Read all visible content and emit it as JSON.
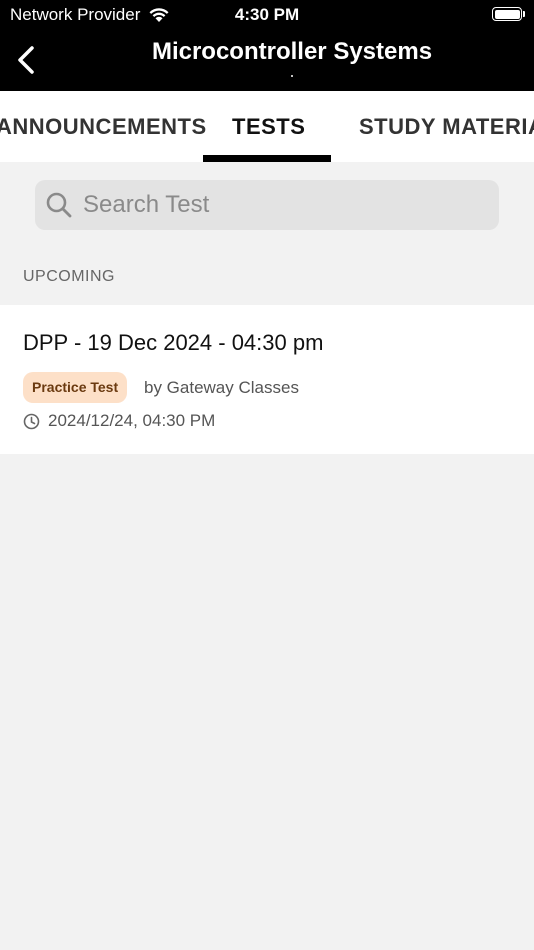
{
  "status": {
    "carrier": "Network Provider",
    "time": "4:30 PM"
  },
  "header": {
    "title": "Microcontroller Systems"
  },
  "tabs": [
    {
      "label": "ANNOUNCEMENTS"
    },
    {
      "label": "TESTS"
    },
    {
      "label": "STUDY MATERIAL"
    }
  ],
  "search": {
    "placeholder": "Search Test",
    "value": ""
  },
  "section": {
    "label": "UPCOMING"
  },
  "tests": [
    {
      "title": "DPP - 19 Dec 2024 - 04:30 pm",
      "badge": "Practice Test",
      "author": "by Gateway Classes",
      "datetime": "2024/12/24, 04:30 PM"
    }
  ],
  "colors": {
    "header_bg": "#000000",
    "badge_bg": "#fde0c8",
    "badge_text": "#6b3a10",
    "page_bg": "#f2f2f2"
  },
  "icons": {
    "back": "chevron-left-icon",
    "search": "search-icon",
    "clock": "clock-icon",
    "wifi": "wifi-icon",
    "battery": "battery-icon"
  }
}
